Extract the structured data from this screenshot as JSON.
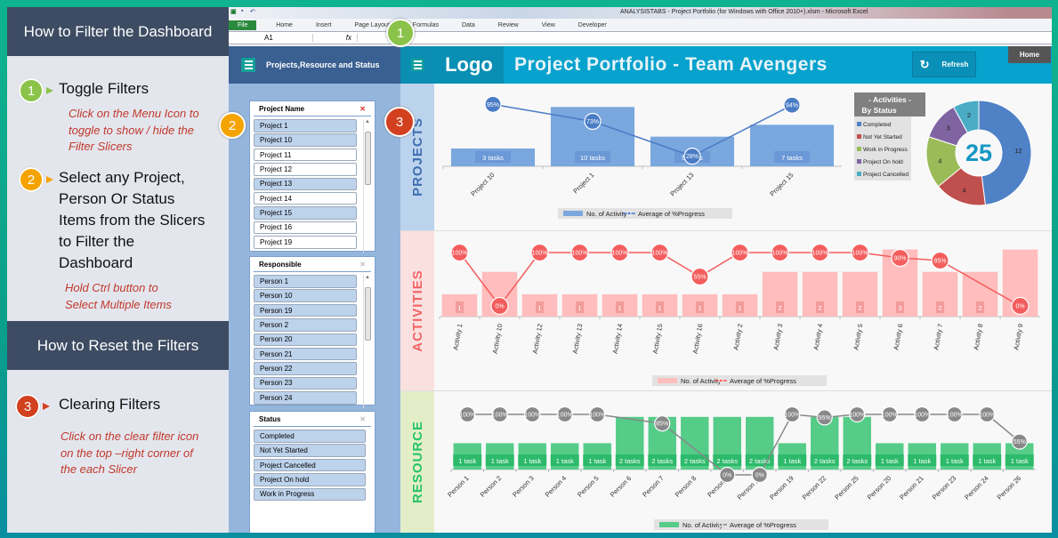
{
  "guide": {
    "filter_header": "How to Filter the Dashboard",
    "reset_header": "How to Reset the Filters",
    "steps": [
      {
        "num": "1",
        "title": "Toggle Filters",
        "hint": "Click on the Menu Icon to toggle to show / hide the Filter Slicers",
        "color": "#8bc34a"
      },
      {
        "num": "2",
        "title": "Select any Project, Person Or Status Items from the Slicers to Filter the Dashboard",
        "hint": "Hold Ctrl button to Select Multiple Items",
        "color": "#f5a300"
      },
      {
        "num": "3",
        "title": "Clearing Filters",
        "hint": "Click on the clear filter icon on the top –right corner of the each Slicer",
        "color": "#d2401f"
      }
    ]
  },
  "excel": {
    "title": "ANALYSISTABS - Project Portfolio (for Windows with Office 2010+).xlsm  -  Microsoft Excel",
    "tabs": [
      "File",
      "Home",
      "Insert",
      "Page Layout",
      "Formulas",
      "Data",
      "Review",
      "View",
      "Developer"
    ],
    "name_box": "A1",
    "fx": "fx"
  },
  "panel": {
    "title": "Projects,Resource and Status",
    "slicers": [
      {
        "title": "Project Name",
        "filtered": true,
        "items": [
          {
            "label": "Project 1",
            "selected": true
          },
          {
            "label": "Project 10",
            "selected": true
          },
          {
            "label": "Project 11",
            "selected": false
          },
          {
            "label": "Project 12",
            "selected": false
          },
          {
            "label": "Project 13",
            "selected": true
          },
          {
            "label": "Project 14",
            "selected": false
          },
          {
            "label": "Project 15",
            "selected": true
          },
          {
            "label": "Project 16",
            "selected": false
          },
          {
            "label": "Project 19",
            "selected": false
          }
        ]
      },
      {
        "title": "Responsible",
        "filtered": false,
        "items": [
          {
            "label": "Person 1",
            "selected": true
          },
          {
            "label": "Person 10",
            "selected": true
          },
          {
            "label": "Person 19",
            "selected": true
          },
          {
            "label": "Person 2",
            "selected": true
          },
          {
            "label": "Person 20",
            "selected": true
          },
          {
            "label": "Person 21",
            "selected": true
          },
          {
            "label": "Person 22",
            "selected": true
          },
          {
            "label": "Person 23",
            "selected": true
          },
          {
            "label": "Person 24",
            "selected": true
          }
        ]
      },
      {
        "title": "Status",
        "filtered": false,
        "items": [
          {
            "label": "Completed",
            "selected": true
          },
          {
            "label": "Not Yet Started",
            "selected": true
          },
          {
            "label": "Project Cancelled",
            "selected": true
          },
          {
            "label": "Project On hold",
            "selected": true
          },
          {
            "label": "Work in Progress",
            "selected": true
          }
        ]
      }
    ]
  },
  "header": {
    "logo": "Logo",
    "title": "Project Portfolio - Team Avengers",
    "refresh": "Refresh",
    "home": "Home"
  },
  "sections": {
    "projects": "PROJECTS",
    "activities": "ACTIVITIES",
    "resource": "RESOURCE"
  },
  "chart_data": [
    {
      "type": "bar",
      "title": "Projects",
      "categories": [
        "Project 10",
        "Project 1",
        "Project 13",
        "Project 15"
      ],
      "series": [
        {
          "name": "No. of Activity",
          "values": [
            3,
            10,
            5,
            7
          ],
          "labels": [
            "3  tasks",
            "10  tasks",
            "5  tasks",
            "7  tasks"
          ],
          "color": "#7aa7de"
        },
        {
          "name": "Average of %Progress",
          "type": "line",
          "values": [
            95,
            73,
            28,
            94
          ],
          "color": "#4a7cc6"
        }
      ],
      "ylim": [
        0,
        12
      ],
      "legend": "bottom"
    },
    {
      "type": "pie",
      "title": "- Activities - By Status",
      "center_label": "25",
      "categories": [
        "Completed",
        "Not Yet Started",
        "Work in Progress",
        "Project On hold",
        "Project Cancelled"
      ],
      "values": [
        12,
        4,
        4,
        3,
        2
      ],
      "colors": [
        "#4f81c6",
        "#c0504d",
        "#9bbb59",
        "#8064a2",
        "#4bacc6"
      ],
      "legend": "left"
    },
    {
      "type": "bar",
      "title": "Activities",
      "categories": [
        "Activity 1",
        "Activity 10",
        "Activity 12",
        "Activity 13",
        "Activity 14",
        "Activity 15",
        "Activity 16",
        "Activity 2",
        "Activity 3",
        "Activity 4",
        "Activity 5",
        "Activity 6",
        "Activity 7",
        "Activity 8",
        "Activity 9"
      ],
      "series": [
        {
          "name": "No. of Activity",
          "values": [
            1,
            2,
            1,
            1,
            1,
            1,
            1,
            1,
            2,
            2,
            2,
            3,
            2,
            2,
            3
          ],
          "color": "#ffbdbd"
        },
        {
          "name": "Average of %Progress",
          "type": "line",
          "values": [
            100,
            0,
            100,
            100,
            100,
            100,
            55,
            100,
            100,
            100,
            100,
            90,
            85,
            null,
            0
          ],
          "color": "#f35d5d"
        }
      ],
      "ylim": [
        0,
        3.5
      ],
      "legend": "bottom"
    },
    {
      "type": "bar",
      "title": "Resource",
      "categories": [
        "Person 1",
        "Person 2",
        "Person 3",
        "Person 4",
        "Person 5",
        "Person 6",
        "Person 7",
        "Person 8",
        "Person 9",
        "Person 10",
        "Person 19",
        "Person 22",
        "Person 25",
        "Person 20",
        "Person 21",
        "Person 23",
        "Person 24",
        "Person 26"
      ],
      "series": [
        {
          "name": "No. of Activity",
          "values": [
            1,
            1,
            1,
            1,
            1,
            2,
            2,
            2,
            2,
            2,
            1,
            2,
            2,
            1,
            1,
            1,
            1,
            1
          ],
          "color": "#55cc88"
        },
        {
          "name": "Average of %Progress",
          "type": "line",
          "values": [
            100,
            100,
            100,
            100,
            100,
            null,
            85,
            null,
            0,
            0,
            100,
            95,
            100,
            100,
            100,
            100,
            100,
            55
          ],
          "color": "#888888"
        }
      ],
      "ylim": [
        0,
        2.5
      ],
      "legend": "bottom"
    }
  ]
}
